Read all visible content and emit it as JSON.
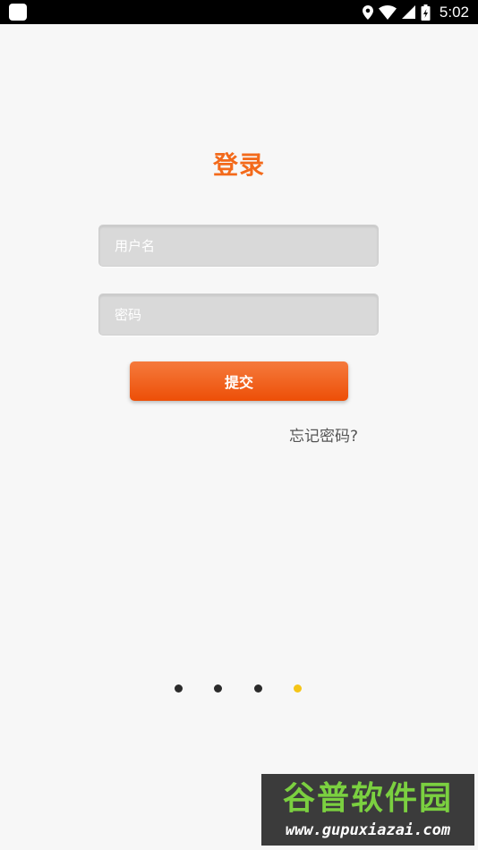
{
  "status_bar": {
    "time": "5:02",
    "icons": [
      "app-notification-icon",
      "location-icon",
      "wifi-icon",
      "cell-signal-icon",
      "battery-icon"
    ]
  },
  "login": {
    "title": "登录",
    "username_placeholder": "用户名",
    "password_placeholder": "密码",
    "submit_label": "提交",
    "forgot_password_label": "忘记密码?"
  },
  "pager": {
    "total": 4,
    "active_index": 3
  },
  "watermark": {
    "brand": "谷普软件园",
    "url": "www.gupuxiazai.com"
  },
  "colors": {
    "accent": "#f36a1b",
    "button": "#ed5a16",
    "active_dot": "#f5c518",
    "field_bg": "#d9d9d9"
  }
}
